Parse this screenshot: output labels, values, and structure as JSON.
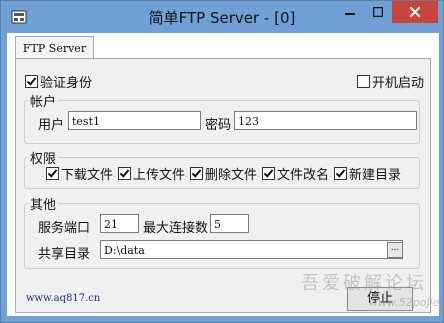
{
  "window": {
    "title": "简单FTP Server - [0]"
  },
  "tab": {
    "label": "FTP Server"
  },
  "auth": {
    "label": "验证身份",
    "checked": true
  },
  "autostart": {
    "label": "开机启动",
    "checked": false
  },
  "account": {
    "legend": "帐户",
    "user_label": "用户",
    "user_value": "test1",
    "password_label": "密码",
    "password_value": "123"
  },
  "permissions": {
    "legend": "权限",
    "items": [
      {
        "label": "下载文件",
        "checked": true
      },
      {
        "label": "上传文件",
        "checked": true
      },
      {
        "label": "删除文件",
        "checked": true
      },
      {
        "label": "文件改名",
        "checked": true
      },
      {
        "label": "新建目录",
        "checked": true
      }
    ]
  },
  "other": {
    "legend": "其他",
    "port_label": "服务端口",
    "port_value": "21",
    "maxconn_label": "最大连接数",
    "maxconn_value": "5",
    "share_label": "共享目录",
    "share_value": "D:\\data",
    "browse_label": "..."
  },
  "footer": {
    "link": "www.aq817.cn",
    "stop_label": "停止"
  },
  "watermark": {
    "text": "吾爱破解论坛",
    "sub": "www.52pojie.cn"
  }
}
